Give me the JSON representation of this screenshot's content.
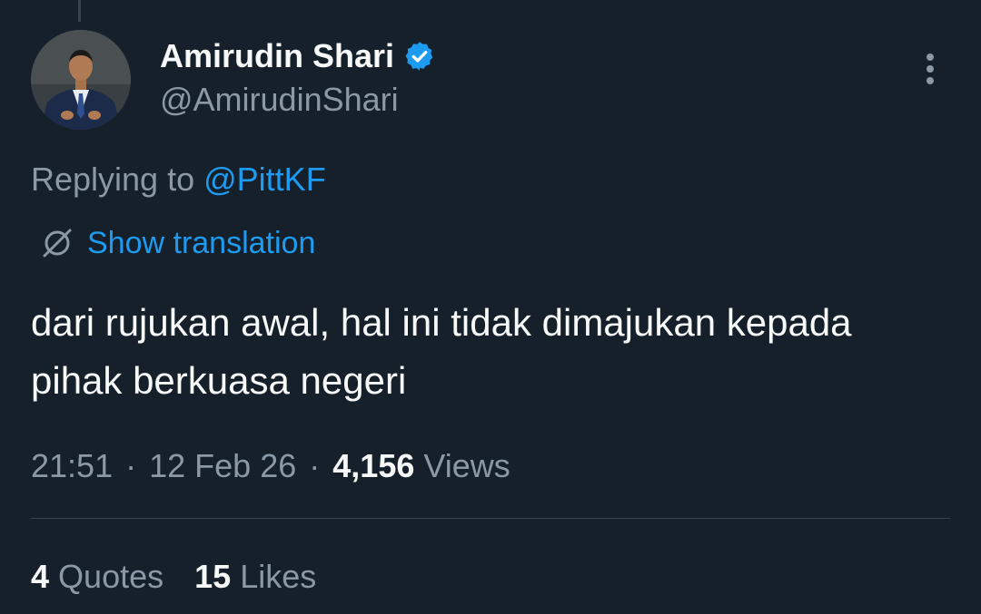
{
  "author": {
    "display_name": "Amirudin Shari",
    "handle": "@AmirudinShari",
    "verified": true
  },
  "reply": {
    "prefix": "Replying to",
    "mention": "@PittKF"
  },
  "translate": {
    "label": "Show translation",
    "icon": "globe-icon"
  },
  "tweet": {
    "text": "dari rujukan awal, hal ini tidak dimajukan kepada pihak berkuasa negeri"
  },
  "meta": {
    "time": "21:51",
    "date": "12 Feb 26",
    "views_count": "4,156",
    "views_label": "Views"
  },
  "stats": {
    "quotes_count": "4",
    "quotes_label": "Quotes",
    "likes_count": "15",
    "likes_label": "Likes"
  },
  "colors": {
    "background": "#15202b",
    "text": "#f7f9f9",
    "secondary": "#8b98a5",
    "link": "#1d9bf0",
    "divider": "#38444d"
  }
}
